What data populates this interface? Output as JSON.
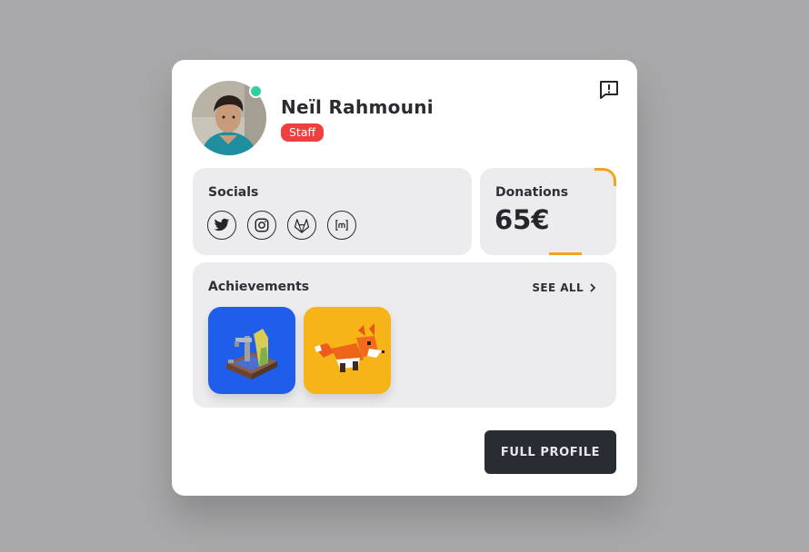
{
  "profile": {
    "name": "Neïl Rahmouni",
    "role_badge": "Staff",
    "status": "online",
    "status_color": "#2fcf9f",
    "badge_color": "#ef3f3f"
  },
  "header": {
    "report_icon": "report-feedback-icon"
  },
  "socials": {
    "title": "Socials",
    "links": [
      {
        "icon": "twitter-icon"
      },
      {
        "icon": "instagram-icon"
      },
      {
        "icon": "gitlab-icon"
      },
      {
        "icon": "malt-icon"
      }
    ]
  },
  "donations": {
    "title": "Donations",
    "amount": "65€",
    "accent_color": "#f5a31b"
  },
  "achievements": {
    "title": "Achievements",
    "see_all_label": "SEE ALL",
    "items": [
      {
        "icon": "fountain-achievement-icon",
        "background": "#1f5eea"
      },
      {
        "icon": "fox-achievement-icon",
        "background": "#f7b418"
      }
    ]
  },
  "actions": {
    "full_profile_label": "FULL PROFILE"
  }
}
